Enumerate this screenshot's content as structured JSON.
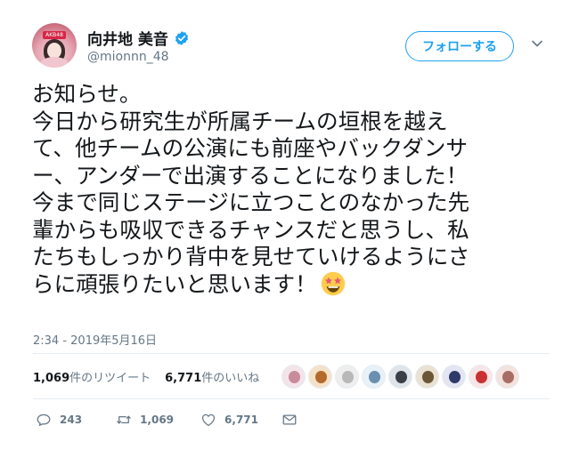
{
  "author": {
    "display_name": "向井地 美音",
    "handle": "@mionnn_48",
    "avatar_badge": "AKB48",
    "verified": true
  },
  "follow_button": {
    "label": "フォローする"
  },
  "tweet": {
    "lines": [
      "お知らせ。",
      "今日から研究生が所属チームの垣根を越え",
      "て、他チームの公演にも前座やバックダンサ",
      "ー、アンダーで出演することになりました！",
      "今まで同じステージに立つことのなかった先",
      "輩からも吸収できるチャンスだと思うし、私",
      "たちもしっかり背中を見せていけるようにさ",
      "らに頑張りたいと思います！"
    ],
    "emoji": "star-struck-emoji",
    "timestamp": "2:34 - 2019年5月16日"
  },
  "stats": {
    "retweets_count": "1,069",
    "retweets_label": "件のリツイート",
    "likes_count": "6,771",
    "likes_label": "件のいいね"
  },
  "likers": [
    {
      "bg": "#f3e4ea",
      "fg": "#c98b9c"
    },
    {
      "bg": "#f5e1c8",
      "fg": "#b36a2c"
    },
    {
      "bg": "#eeeeee",
      "fg": "#b8b8b8"
    },
    {
      "bg": "#e8f1f8",
      "fg": "#6a8fb0"
    },
    {
      "bg": "#dfe4ea",
      "fg": "#3a3f47"
    },
    {
      "bg": "#e9e1d1",
      "fg": "#6b5638"
    },
    {
      "bg": "#e3e6f2",
      "fg": "#2f3a6a"
    },
    {
      "bg": "#f8e6e6",
      "fg": "#c83232"
    },
    {
      "bg": "#f4e2de",
      "fg": "#a86e64"
    }
  ],
  "actions": {
    "reply_count": "243",
    "retweet_count": "1,069",
    "like_count": "6,771"
  },
  "colors": {
    "accent": "#1da1f2",
    "secondary_text": "#657786",
    "verified": "#1da1f2"
  }
}
